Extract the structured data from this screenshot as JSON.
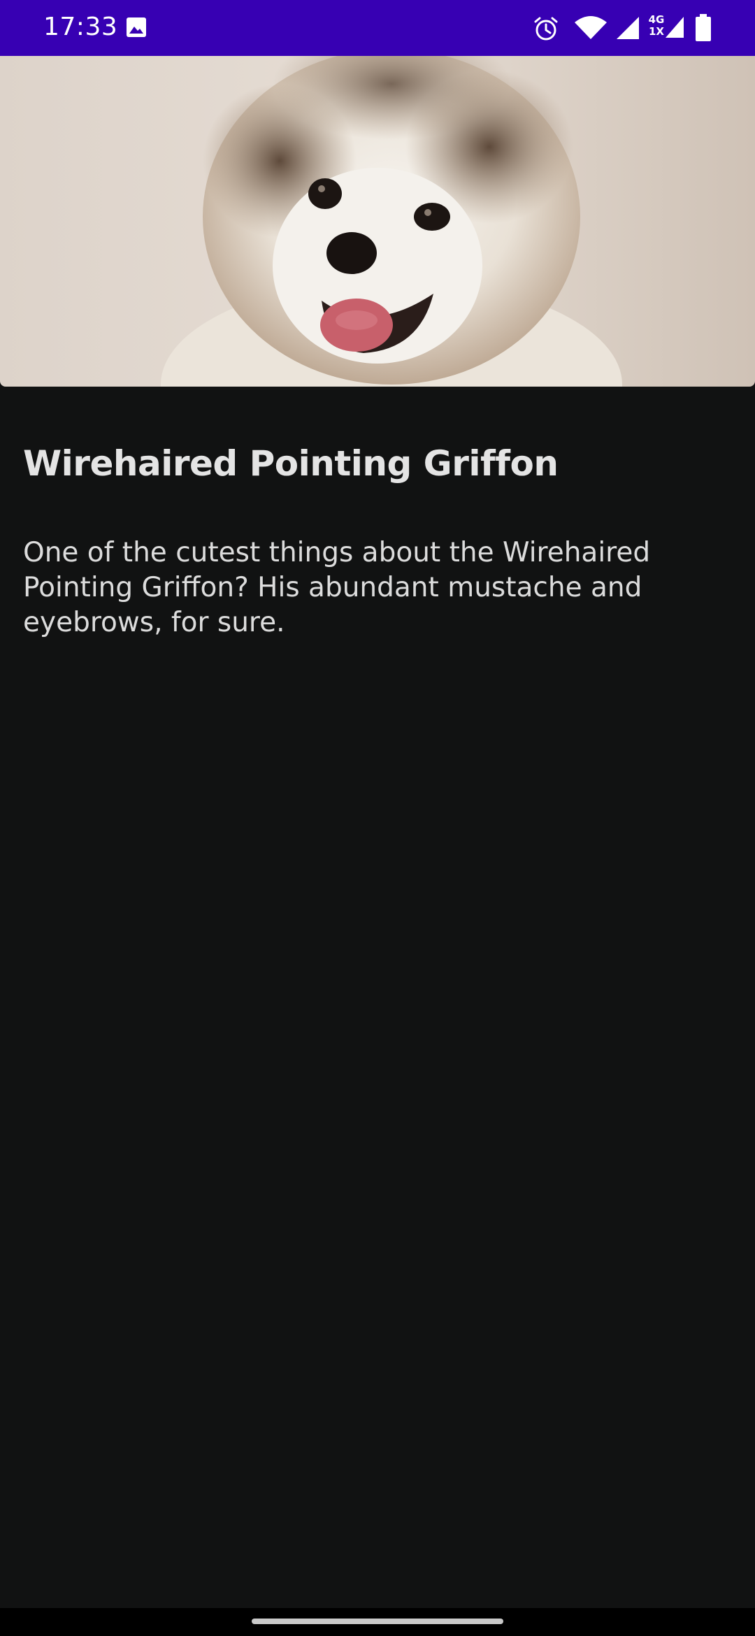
{
  "status_bar": {
    "time": "17:33",
    "network_top": "4G",
    "network_bottom": "1X",
    "icons": [
      "gallery-icon",
      "alarm-icon",
      "wifi-icon",
      "signal-icon",
      "signal-icon",
      "battery-icon"
    ]
  },
  "hero": {
    "image": "dog-photo",
    "colors": {
      "background": "#d9cfc6",
      "fur_light": "#f2efe9",
      "fur_dark": "#6a5545",
      "tongue": "#c8606b"
    }
  },
  "content": {
    "title": "Wirehaired Pointing Griffon",
    "description": "One of the cutest things about the Wirehaired Pointing Griffon? His abundant mustache and eyebrows, for sure."
  },
  "theme": {
    "status_bar_color": "#3700B3",
    "background_color": "#111212",
    "text_color": "#e4e4e4"
  }
}
